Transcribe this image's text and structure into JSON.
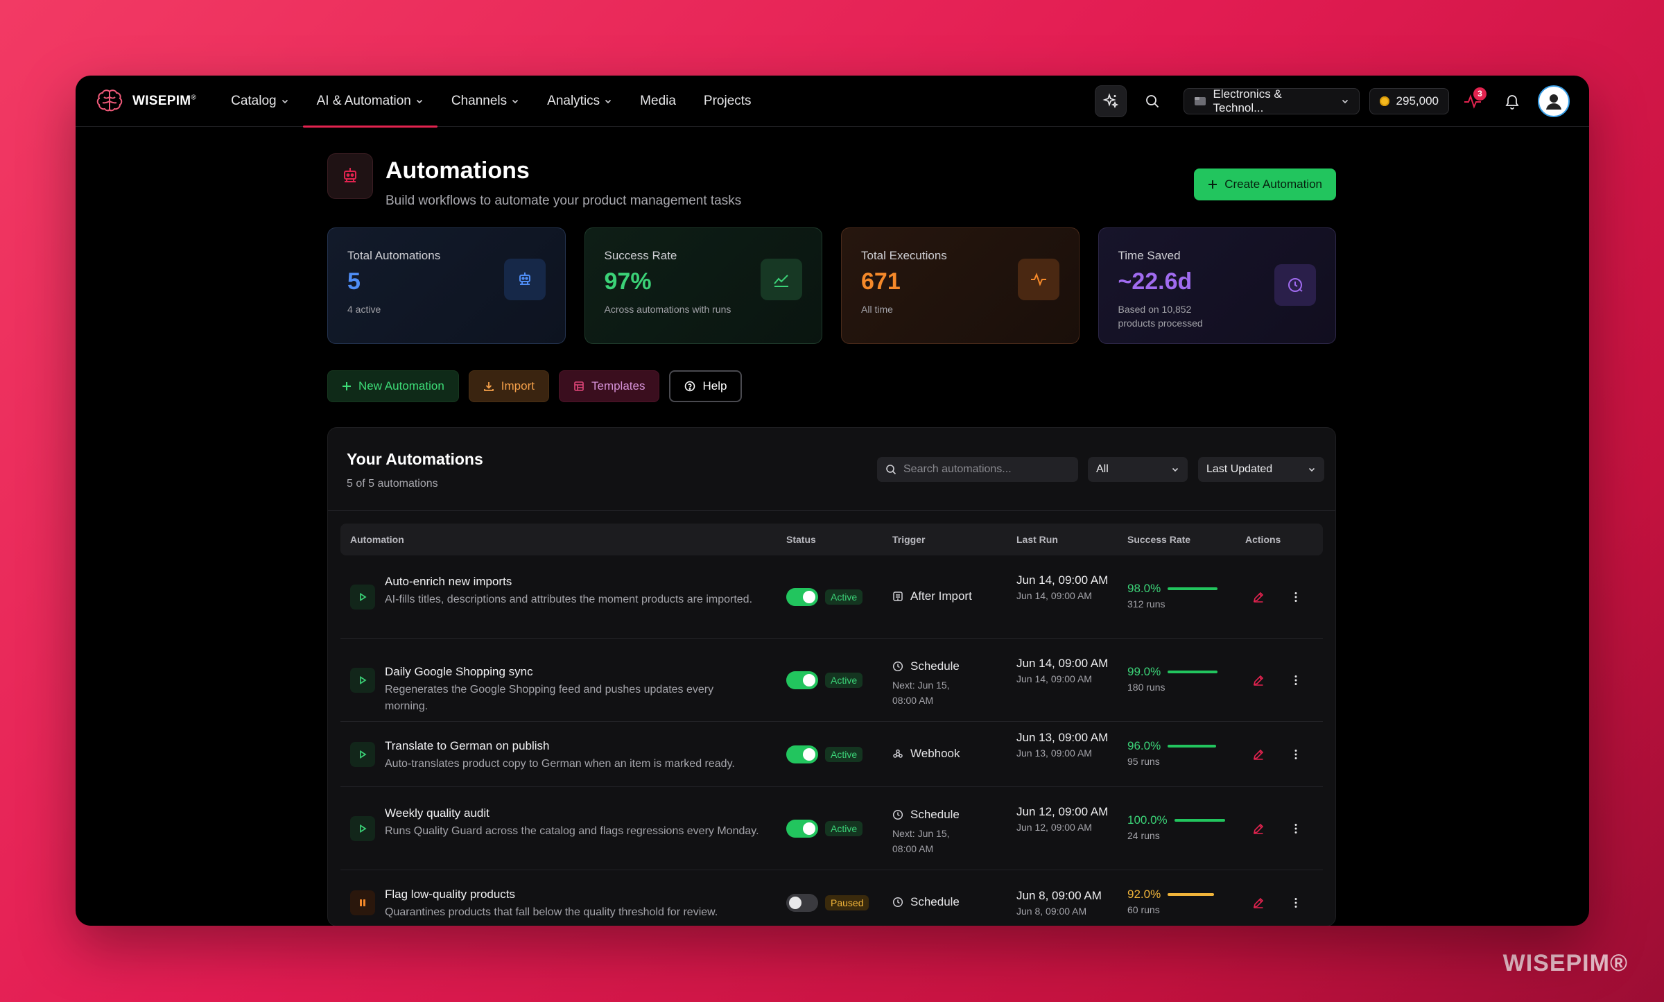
{
  "brand": {
    "name": "WISEPIM",
    "mark": "®",
    "watermark": "WISEPIM®"
  },
  "nav": {
    "items": [
      {
        "label": "Catalog",
        "dropdown": true,
        "active": false
      },
      {
        "label": "AI & Automation",
        "dropdown": true,
        "active": true
      },
      {
        "label": "Channels",
        "dropdown": true,
        "active": false
      },
      {
        "label": "Analytics",
        "dropdown": true,
        "active": false
      },
      {
        "label": "Media",
        "dropdown": false,
        "active": false
      },
      {
        "label": "Projects",
        "dropdown": false,
        "active": false
      }
    ],
    "workspace": "Electronics & Technol...",
    "credits": "295,000",
    "notification_count": "3",
    "accent": "#e2234f"
  },
  "page": {
    "title": "Automations",
    "subtitle": "Build workflows to automate your product management tasks",
    "create_button": "Create Automation"
  },
  "stats": [
    {
      "label": "Total Automations",
      "value": "5",
      "sub": "4 active",
      "color": "#4f8df5",
      "icon": "robot-icon"
    },
    {
      "label": "Success Rate",
      "value": "97%",
      "sub": "Across automations with runs",
      "color": "#3bd277",
      "icon": "chart-line-icon"
    },
    {
      "label": "Total Executions",
      "value": "671",
      "sub": "All time",
      "color": "#f5892a",
      "icon": "activity-icon"
    },
    {
      "label": "Time Saved",
      "value": "~22.6d",
      "sub": "Based on 10,852 products processed",
      "color": "#a06bf0",
      "icon": "clock-icon"
    }
  ],
  "actions": {
    "new": "New Automation",
    "import": "Import",
    "templates": "Templates",
    "help": "Help"
  },
  "panel": {
    "title": "Your Automations",
    "count": "5 of 5 automations",
    "search_placeholder": "Search automations...",
    "filter": "All",
    "sort": "Last Updated",
    "columns": [
      "Automation",
      "Status",
      "Trigger",
      "Last Run",
      "Success Rate",
      "Actions"
    ]
  },
  "rows": [
    {
      "name": "Auto-enrich new imports",
      "desc": "AI-fills titles, descriptions and attributes the moment products are imported.",
      "enabled": true,
      "status": "Active",
      "trigger": "After Import",
      "trigger_icon": "import-trigger-icon",
      "next": "",
      "last_run": "Jun 14, 09:00 AM",
      "last_run_sub": "Jun 14, 09:00 AM",
      "rate": "98.0%",
      "rate_value": 98.0,
      "runs": "312 runs"
    },
    {
      "name": "Daily Google Shopping sync",
      "desc": "Regenerates the Google Shopping feed and pushes updates every morning.",
      "enabled": true,
      "status": "Active",
      "trigger": "Schedule",
      "trigger_icon": "clock-icon",
      "next": "Next: Jun 15, 08:00 AM",
      "last_run": "Jun 14, 09:00 AM",
      "last_run_sub": "Jun 14, 09:00 AM",
      "rate": "99.0%",
      "rate_value": 99.0,
      "runs": "180 runs"
    },
    {
      "name": "Translate to German on publish",
      "desc": "Auto-translates product copy to German when an item is marked ready.",
      "enabled": true,
      "status": "Active",
      "trigger": "Webhook",
      "trigger_icon": "webhook-icon",
      "next": "",
      "last_run": "Jun 13, 09:00 AM",
      "last_run_sub": "Jun 13, 09:00 AM",
      "rate": "96.0%",
      "rate_value": 96.0,
      "runs": "95 runs"
    },
    {
      "name": "Weekly quality audit",
      "desc": "Runs Quality Guard across the catalog and flags regressions every Monday.",
      "enabled": true,
      "status": "Active",
      "trigger": "Schedule",
      "trigger_icon": "clock-icon",
      "next": "Next: Jun 15, 08:00 AM",
      "last_run": "Jun 12, 09:00 AM",
      "last_run_sub": "Jun 12, 09:00 AM",
      "rate": "100.0%",
      "rate_value": 100.0,
      "runs": "24 runs"
    },
    {
      "name": "Flag low-quality products",
      "desc": "Quarantines products that fall below the quality threshold for review.",
      "enabled": false,
      "status": "Paused",
      "trigger": "Schedule",
      "trigger_icon": "clock-icon",
      "next": "",
      "last_run": "Jun 8, 09:00 AM",
      "last_run_sub": "Jun 8, 09:00 AM",
      "rate": "92.0%",
      "rate_value": 92.0,
      "runs": "60 runs"
    }
  ]
}
